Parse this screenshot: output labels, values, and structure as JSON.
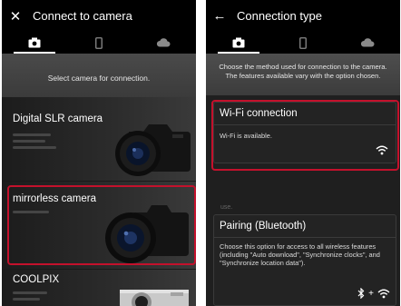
{
  "left": {
    "title": "Connect to camera",
    "close_icon": "close-icon",
    "tabs": [
      "camera-icon",
      "phone-icon",
      "cloud-icon"
    ],
    "intro": "Select camera for connection.",
    "cards": [
      {
        "title": "Digital SLR camera"
      },
      {
        "title": "mirrorless camera"
      },
      {
        "title": "COOLPIX"
      }
    ],
    "highlight_color": "#c4112c"
  },
  "right": {
    "title": "Connection type",
    "back_icon": "back-arrow-icon",
    "tabs": [
      "camera-icon",
      "phone-icon",
      "cloud-icon"
    ],
    "intro": "Choose the method used for connection to the camera.\nThe features available vary with the option chosen.",
    "wifi": {
      "title": "Wi-Fi connection",
      "status": "Wi-Fi is available.",
      "icon": "wifi-icon"
    },
    "use_fragment": "use.",
    "pairing": {
      "title": "Pairing (Bluetooth)",
      "description": "Choose this option for access to all wireless features\n(including \"Auto download\", \"Synchronize clocks\", and \"Synchronize location data\").",
      "icons": [
        "bluetooth-icon",
        "plus",
        "wifi-icon"
      ],
      "plus": "+"
    },
    "highlight_color": "#c4112c"
  }
}
